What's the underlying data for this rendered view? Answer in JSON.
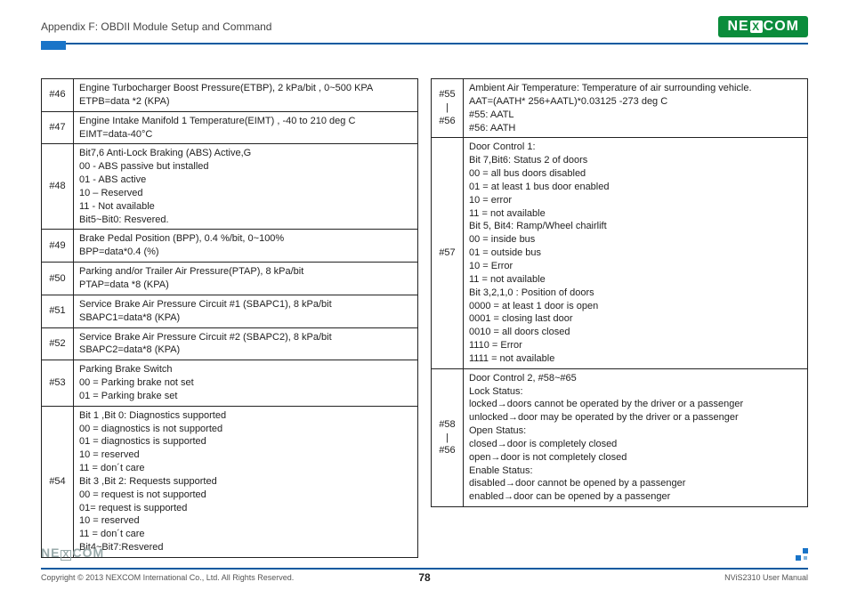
{
  "header": {
    "appendix": "Appendix F: OBDII Module Setup and Command",
    "brand_left": "NE",
    "brand_x": "X",
    "brand_right": "COM"
  },
  "left_rows": [
    {
      "id": "#46",
      "text": "Engine Turbocharger Boost Pressure(ETBP), 2 kPa/bit , 0~500 KPA\nETPB=data *2 (KPA)"
    },
    {
      "id": "#47",
      "text": "Engine Intake Manifold 1 Temperature(EIMT) , -40 to 210 deg C\nEIMT=data-40°C"
    },
    {
      "id": "#48",
      "text": "Bit7,6 Anti-Lock Braking (ABS) Active,G\n00 - ABS passive but installed\n01 - ABS active\n10 – Reserved\n11 - Not available\nBit5~Bit0: Resvered."
    },
    {
      "id": "#49",
      "text": "Brake Pedal Position (BPP), 0.4 %/bit, 0~100%\nBPP=data*0.4 (%)"
    },
    {
      "id": "#50",
      "text": "Parking and/or Trailer Air Pressure(PTAP), 8 kPa/bit\nPTAP=data *8 (KPA)"
    },
    {
      "id": "#51",
      "text": "Service Brake Air Pressure Circuit #1 (SBAPC1), 8 kPa/bit\nSBAPC1=data*8 (KPA)"
    },
    {
      "id": "#52",
      "text": "Service Brake Air Pressure Circuit #2 (SBAPC2), 8 kPa/bit\nSBAPC2=data*8 (KPA)"
    },
    {
      "id": "#53",
      "text": "Parking Brake Switch\n00 = Parking brake not set\n01 = Parking brake set"
    },
    {
      "id": "#54",
      "text": "Bit 1 ,Bit 0: Diagnostics supported\n00 = diagnostics is not supported\n01 = diagnostics is supported\n10 = reserved\n11 = don´t care\nBit 3 ,Bit 2: Requests supported\n00 = request is not supported\n01= request is supported\n10 = reserved\n11 = don´t care\nBit4~Bit7:Resvered"
    }
  ],
  "right_rows": [
    {
      "id": "#55\n|\n#56",
      "text": "Ambient Air Temperature: Temperature of air surrounding vehicle.\nAAT=(AATH* 256+AATL)*0.03125 -273 deg C\n#55: AATL\n#56: AATH"
    },
    {
      "id": "#57",
      "text": "Door Control 1:\nBit 7,Bit6: Status 2 of doors\n00 = all bus doors disabled\n01 = at least 1 bus door enabled\n10 = error\n11 = not available\nBit 5, Bit4: Ramp/Wheel chairlift\n00 = inside bus\n01 = outside bus\n10 = Error\n11 = not available\nBit 3,2,1,0 : Position of doors\n0000 = at least 1 door is open\n0001 = closing last door\n0010 = all doors closed\n1110 = Error\n1111 = not available"
    },
    {
      "id": "#58\n|\n#56",
      "text": "Door Control 2, #58~#65\nLock Status:\nlocked→doors cannot be operated by the driver or a passenger\nunlocked→door may be operated by the driver or a passenger\nOpen Status:\nclosed→door is completely closed\nopen→door is not completely closed\nEnable Status:\ndisabled→door cannot be opened by a passenger\nenabled→door can be opened by a passenger"
    }
  ],
  "footer": {
    "copyright": "Copyright © 2013 NEXCOM International Co., Ltd. All Rights Reserved.",
    "page": "78",
    "manual": "NViS2310 User Manual",
    "flogo_left": "NE",
    "flogo_x": "X",
    "flogo_right": "COM"
  }
}
